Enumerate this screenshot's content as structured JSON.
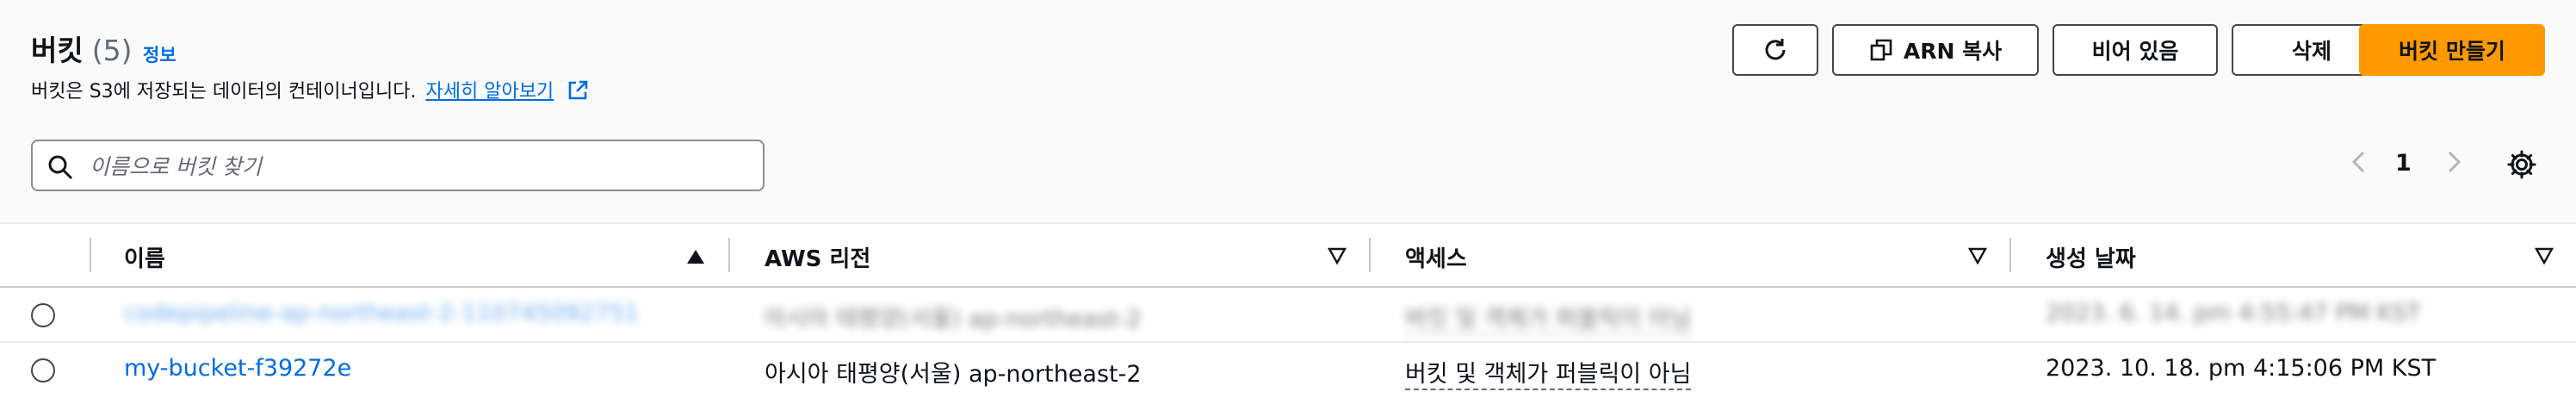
{
  "header": {
    "title": "버킷",
    "count": "(5)",
    "info_link": "정보",
    "description": "버킷은 S3에 저장되는 데이터의 컨테이너입니다.",
    "learn_more": "자세히 알아보기"
  },
  "actions": {
    "refresh_icon": "refresh-icon",
    "copy_arn": "ARN 복사",
    "empty": "비어 있음",
    "delete": "삭제",
    "create": "버킷 만들기"
  },
  "search": {
    "placeholder": "이름으로 버킷 찾기",
    "value": ""
  },
  "pagination": {
    "current_page": "1"
  },
  "table": {
    "columns": [
      "이름",
      "AWS 리전",
      "액세스",
      "생성 날짜"
    ],
    "rows": [
      {
        "name": "codepipeline-ap-northeast-2-110745092751",
        "region": "아시아 태평양(서울) ap-northeast-2",
        "access": "버킷 및 객체가 퍼블릭이 아님",
        "created": "2023. 6. 14. pm 4:55:47 PM KST",
        "blurred": true
      },
      {
        "name": "my-bucket-f39272e",
        "region": "아시아 태평양(서울) ap-northeast-2",
        "access": "버킷 및 객체가 퍼블릭이 아님",
        "created": "2023. 10. 18. pm 4:15:06 PM KST",
        "blurred": false
      }
    ]
  },
  "colors": {
    "accent": "#006ce0",
    "primary_button": "#ff9900",
    "border": "#424650"
  }
}
